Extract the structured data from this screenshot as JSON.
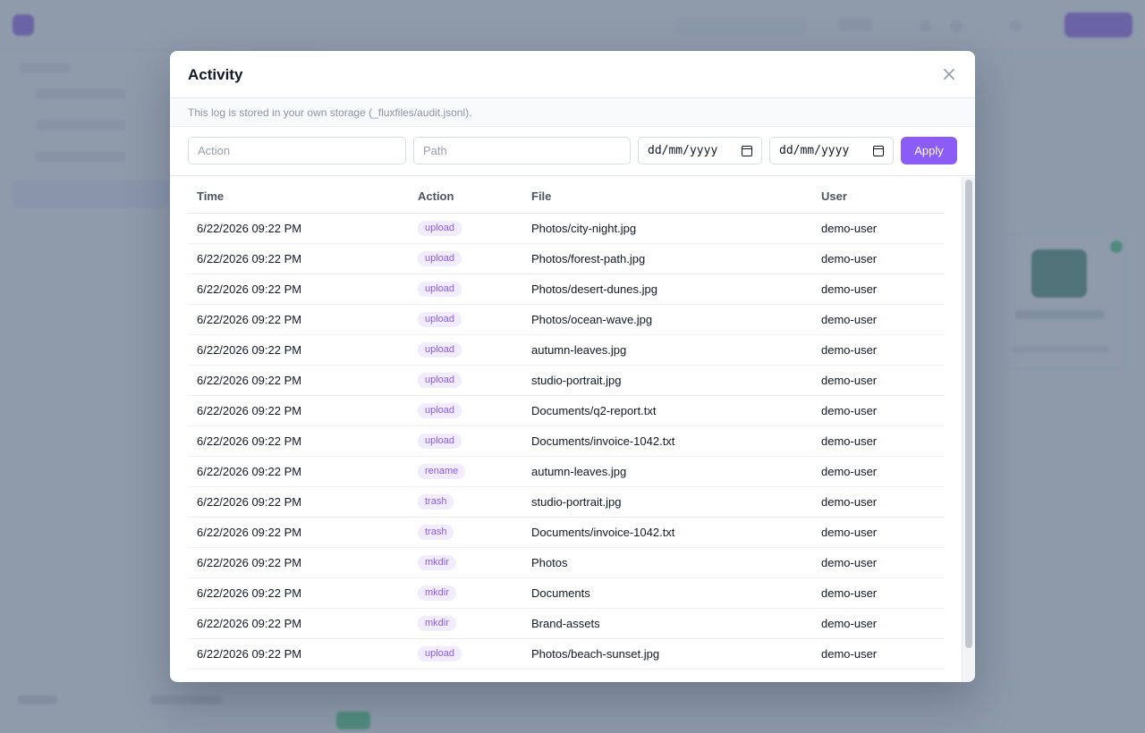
{
  "modal": {
    "title": "Activity",
    "close_label": "×",
    "note": "This log is stored in your own storage (_fluxfiles/audit.jsonl)."
  },
  "filters": {
    "action_placeholder": "Action",
    "path_placeholder": "Path",
    "from_date_placeholder": "dd/mm/yyyy",
    "to_date_placeholder": "dd/mm/yyyy",
    "apply_label": "Apply"
  },
  "table": {
    "headers": {
      "time": "Time",
      "action": "Action",
      "file": "File",
      "user": "User"
    },
    "rows": [
      {
        "time": "6/22/2026 09:22 PM",
        "action": "upload",
        "file": "Photos/city-night.jpg",
        "user": "demo-user"
      },
      {
        "time": "6/22/2026 09:22 PM",
        "action": "upload",
        "file": "Photos/forest-path.jpg",
        "user": "demo-user"
      },
      {
        "time": "6/22/2026 09:22 PM",
        "action": "upload",
        "file": "Photos/desert-dunes.jpg",
        "user": "demo-user"
      },
      {
        "time": "6/22/2026 09:22 PM",
        "action": "upload",
        "file": "Photos/ocean-wave.jpg",
        "user": "demo-user"
      },
      {
        "time": "6/22/2026 09:22 PM",
        "action": "upload",
        "file": "autumn-leaves.jpg",
        "user": "demo-user"
      },
      {
        "time": "6/22/2026 09:22 PM",
        "action": "upload",
        "file": "studio-portrait.jpg",
        "user": "demo-user"
      },
      {
        "time": "6/22/2026 09:22 PM",
        "action": "upload",
        "file": "Documents/q2-report.txt",
        "user": "demo-user"
      },
      {
        "time": "6/22/2026 09:22 PM",
        "action": "upload",
        "file": "Documents/invoice-1042.txt",
        "user": "demo-user"
      },
      {
        "time": "6/22/2026 09:22 PM",
        "action": "rename",
        "file": "autumn-leaves.jpg",
        "user": "demo-user"
      },
      {
        "time": "6/22/2026 09:22 PM",
        "action": "trash",
        "file": "studio-portrait.jpg",
        "user": "demo-user"
      },
      {
        "time": "6/22/2026 09:22 PM",
        "action": "trash",
        "file": "Documents/invoice-1042.txt",
        "user": "demo-user"
      },
      {
        "time": "6/22/2026 09:22 PM",
        "action": "mkdir",
        "file": "Photos",
        "user": "demo-user"
      },
      {
        "time": "6/22/2026 09:22 PM",
        "action": "mkdir",
        "file": "Documents",
        "user": "demo-user"
      },
      {
        "time": "6/22/2026 09:22 PM",
        "action": "mkdir",
        "file": "Brand-assets",
        "user": "demo-user"
      },
      {
        "time": "6/22/2026 09:22 PM",
        "action": "upload",
        "file": "Photos/beach-sunset.jpg",
        "user": "demo-user"
      }
    ]
  },
  "colors": {
    "accent": "#8b5cf6",
    "badge_bg": "#f1ecfe",
    "overlay": "#64748b"
  },
  "icons": {
    "close": "close-icon",
    "calendar": "calendar-icon"
  }
}
